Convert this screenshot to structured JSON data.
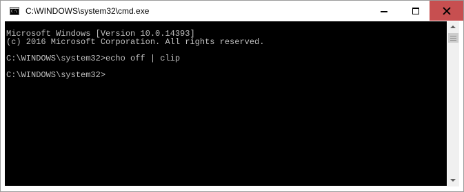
{
  "window": {
    "title": "C:\\WINDOWS\\system32\\cmd.exe",
    "icon_name": "cmd-icon",
    "icon_text": "C:\\"
  },
  "controls": {
    "minimize_icon": "minimize-icon",
    "maximize_icon": "maximize-icon",
    "close_icon": "close-icon",
    "close_hover_color": "#c74f50"
  },
  "console": {
    "background": "#000000",
    "foreground": "#c0c0c0",
    "lines": [
      "Microsoft Windows [Version 10.0.14393]",
      "(c) 2016 Microsoft Corporation. All rights reserved.",
      "",
      "C:\\WINDOWS\\system32>echo off | clip",
      "",
      "C:\\WINDOWS\\system32>"
    ]
  },
  "scrollbar": {
    "up_icon": "scroll-up-icon",
    "down_icon": "scroll-down-icon"
  }
}
